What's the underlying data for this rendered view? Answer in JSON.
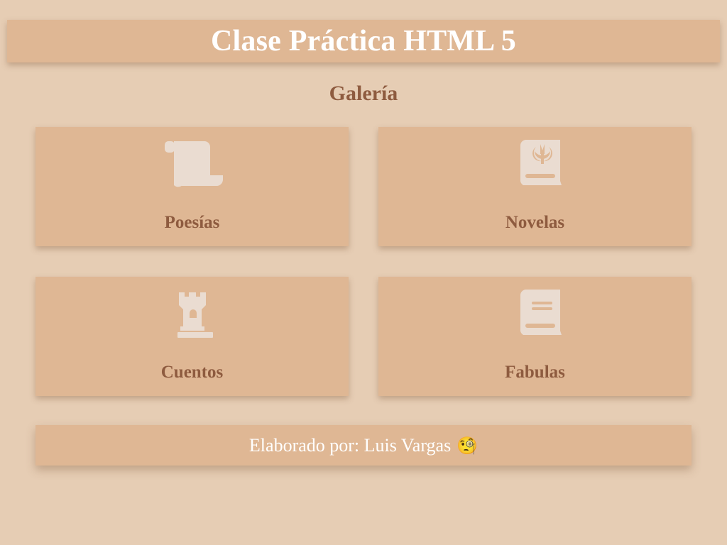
{
  "header": {
    "title": "Clase Práctica HTML 5"
  },
  "gallery": {
    "title": "Galería",
    "cards": [
      {
        "label": "Poesías",
        "icon": "scroll-icon"
      },
      {
        "label": "Novelas",
        "icon": "book-jedi-icon"
      },
      {
        "label": "Cuentos",
        "icon": "chess-rook-icon"
      },
      {
        "label": "Fabulas",
        "icon": "book-icon"
      }
    ]
  },
  "footer": {
    "text": "Elaborado por: Luis Vargas",
    "emoji": "🧐"
  },
  "colors": {
    "background": "#e6cdb4",
    "panel": "#dfb794",
    "heading_text": "#8e5b3f",
    "icon_fill": "#eadcd1",
    "header_text": "#ffffff"
  }
}
